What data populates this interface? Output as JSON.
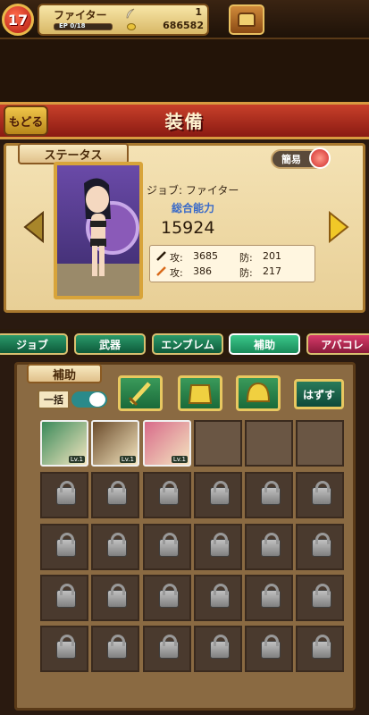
{
  "header": {
    "level": "17",
    "job_name": "ファイター",
    "ep_label": "EP 0/18",
    "ep_progress": 0.0,
    "feathers": "1",
    "gold": "686582",
    "menu_icon": "bag-icon"
  },
  "title": {
    "back_label": "もどる",
    "page_title": "装備"
  },
  "status": {
    "tab_label": "ステータス",
    "simple_label": "簡易",
    "job_line": "ジョブ: ファイター",
    "power_label": "総合能力",
    "power_value": "15924",
    "stats": {
      "atk1_label": "攻:",
      "atk1": "3685",
      "def1_label": "防:",
      "def1": "201",
      "atk2_label": "攻:",
      "atk2": "386",
      "def2_label": "防:",
      "def2": "217"
    }
  },
  "tabs": [
    "ジョブ",
    "武器",
    "エンブレム",
    "補助",
    "アバコレ"
  ],
  "active_tab": "補助",
  "support": {
    "tab_label": "補助",
    "bulk_label": "一括",
    "bulk_on": true,
    "filters": [
      "sword-icon",
      "armor-icon",
      "helmet-icon"
    ],
    "remove_label": "はずす",
    "cards": [
      {
        "lv": "Lv.1",
        "color": "#3a8a5a"
      },
      {
        "lv": "Lv.1",
        "color": "#6a4a2a"
      },
      {
        "lv": "Lv.1",
        "color": "#d86a8a"
      }
    ],
    "empty_slots": 3,
    "locked_rows": 4
  }
}
